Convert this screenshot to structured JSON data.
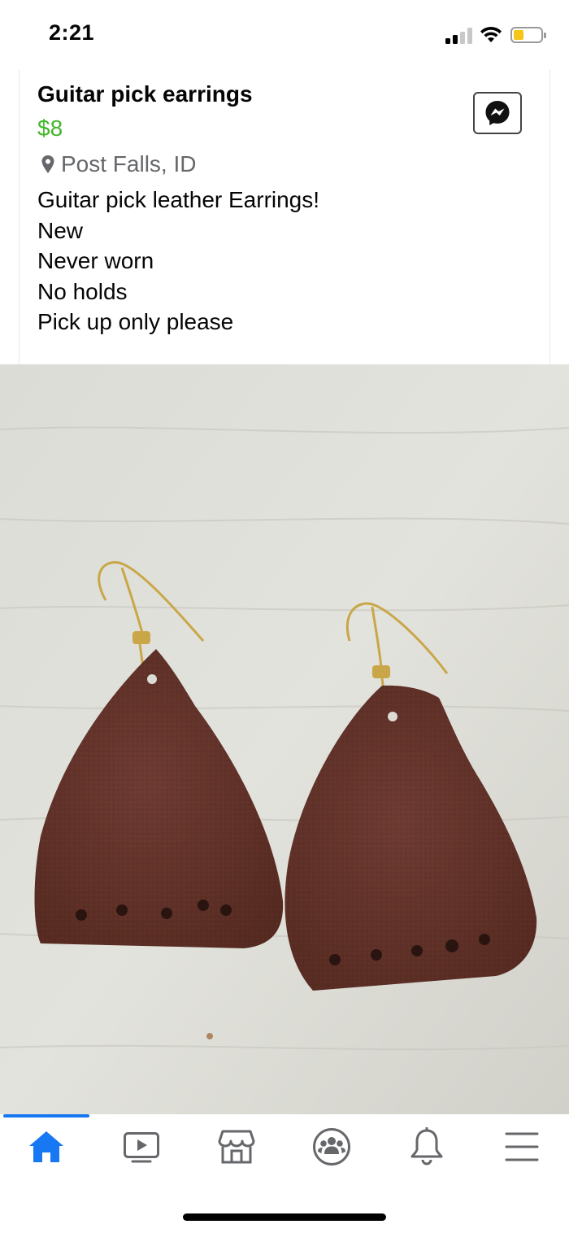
{
  "status_bar": {
    "time": "2:21",
    "signal_icon": "cellular-signal-icon",
    "wifi_icon": "wifi-icon",
    "battery_icon": "battery-icon",
    "battery_level": 0.25,
    "battery_color": "#f5c518"
  },
  "listing": {
    "title": "Guitar pick earrings",
    "price": "$8",
    "price_color": "#42b72a",
    "location": "Post Falls, ID",
    "location_icon": "location-pin-icon",
    "description": [
      "Guitar pick leather Earrings!",
      "New",
      "Never worn",
      "No holds",
      "Pick up only please"
    ],
    "message_button_icon": "messenger-icon"
  },
  "photo": {
    "subject": "leather-earrings-photo"
  },
  "tabbar": {
    "active_color": "#1877f2",
    "tabs": [
      {
        "icon": "home-icon",
        "active": true
      },
      {
        "icon": "watch-video-icon",
        "active": false
      },
      {
        "icon": "marketplace-icon",
        "active": false
      },
      {
        "icon": "groups-icon",
        "active": false
      },
      {
        "icon": "notifications-bell-icon",
        "active": false
      },
      {
        "icon": "menu-icon",
        "active": false
      }
    ]
  }
}
